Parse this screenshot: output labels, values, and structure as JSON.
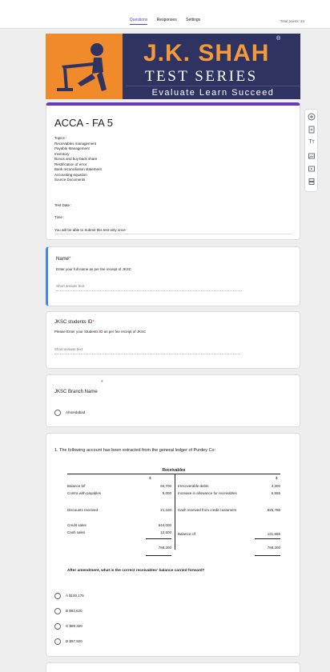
{
  "header": {
    "tabs": [
      "Questions",
      "Responses",
      "Settings"
    ],
    "total_points": "Total points: 34"
  },
  "banner": {
    "brand": "J.K. SHAH",
    "registered": "®",
    "series": "TEST SERIES",
    "tagline": "Evaluate Learn Succeed",
    "colors": {
      "navy": "#2e3362",
      "orange": "#f08a2b"
    }
  },
  "form": {
    "title": "ACCA - FA 5",
    "topics_label": "Topics :",
    "topics": [
      "Receivables management",
      "Payable Management",
      "Inventory",
      "Bonus and buy back share",
      "Rectification of error",
      "Bank reconciliation statement",
      "Accounting equation",
      "Source Documents"
    ],
    "test_date": "Test Date :",
    "time": "Time :",
    "once_note": "You will be able to Submit this test only once"
  },
  "toolbar": {
    "icons": [
      "add-question-icon",
      "import-questions-icon",
      "add-title-icon",
      "add-image-icon",
      "add-video-icon",
      "add-section-icon"
    ],
    "title_glyph": "Tт"
  },
  "q_name": {
    "title": "Name",
    "required": "*",
    "desc": "Enter your full name as per fee receipt of JKSC",
    "hint": "Short answer text"
  },
  "q_id": {
    "title": "JKSC students ID",
    "required": "*",
    "desc": "Please Enter your Students ID as per fee receipt of JKSC",
    "hint": "Short answer text"
  },
  "q_branch": {
    "title": "JKSC Branch Name",
    "required": "*",
    "option": "Ahmedabad"
  },
  "q1": {
    "title": "1. The following account has been extracted from the general ledger of Purdey Co:",
    "table_title": "Receivables",
    "currency": "$",
    "left": [
      {
        "label": "Balance b/f",
        "value": "84,700"
      },
      {
        "label": "Contra with payables",
        "value": "5,000"
      },
      {
        "label": "Discounts received",
        "value": "21,100"
      },
      {
        "label": "Credit sales",
        "value": "644,000"
      },
      {
        "label": "Cash sales",
        "value": "13,500"
      }
    ],
    "right": [
      {
        "label": "Irrecoverable debts",
        "value": "4,300"
      },
      {
        "label": "Increase in allowance for receivables",
        "value": "6,555"
      },
      {
        "label": "Cash received from credit customers",
        "value": "625,780"
      },
      {
        "label": "Balance c/f",
        "value": "131,665"
      }
    ],
    "total_left": "768,300",
    "total_right": "768,300",
    "question": "After amendment, what is the correct receivables' balance carried forward?",
    "options": [
      "A $100,175",
      "B $93,620",
      "C $89,320",
      "D $97,920"
    ]
  }
}
